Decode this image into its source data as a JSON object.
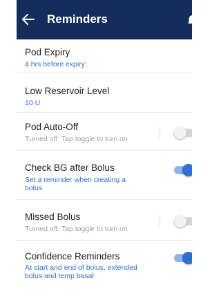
{
  "header": {
    "title": "Reminders",
    "background": "#152d5d",
    "back_icon": "arrow-left-icon",
    "corner_icon": "bell-icon"
  },
  "colors": {
    "accent": "#2f6fd1",
    "toggle_on_track": "#8fb3ea",
    "muted": "#9aa0a6"
  },
  "reminders": [
    {
      "label": "Pod Expiry",
      "detail": "4 hrs before expiry"
    },
    {
      "label": "Low Reservoir Level",
      "detail": "10 U"
    },
    {
      "label": "Pod Auto-Off",
      "detail": "Turned off. Tap toggle to turn on",
      "toggle": "off"
    },
    {
      "label": "Check BG after Bolus",
      "detail_line1": "Set a reminder when creating a",
      "detail_line2": "bolus",
      "toggle": "on"
    },
    {
      "label": "Missed Bolus",
      "detail": "Turned off. Tap toggle to turn on",
      "toggle": "off"
    },
    {
      "label": "Confidence Reminders",
      "detail_line1": "At start and end of bolus, extended",
      "detail_line2": "bolus and temp basal",
      "toggle": "on"
    }
  ]
}
